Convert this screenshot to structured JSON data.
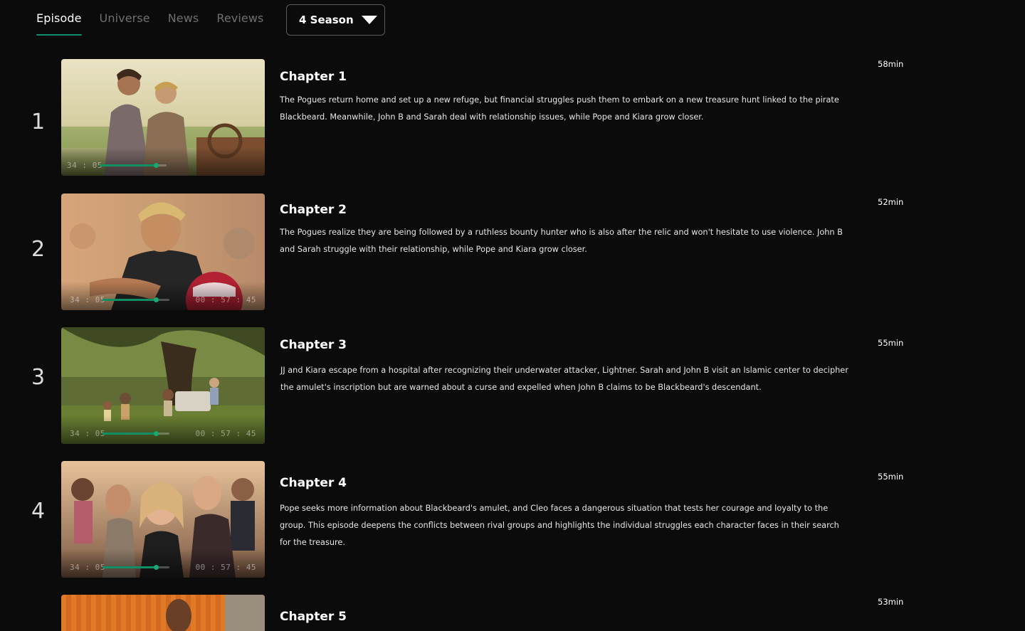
{
  "tabs": [
    {
      "label": "Episode",
      "active": true
    },
    {
      "label": "Universe",
      "active": false
    },
    {
      "label": "News",
      "active": false
    },
    {
      "label": "Reviews",
      "active": false
    }
  ],
  "season_select": {
    "value": "4 Season",
    "icon": "chevron-down-icon"
  },
  "accent_color": "#0f8f6b",
  "episodes": [
    {
      "number": "1",
      "title": "Chapter 1",
      "duration": "58min",
      "description": "The Pogues return home and set up a new refuge, but financial struggles push them to embark on a new treasure hunt linked to the pirate Blackbeard. Meanwhile, John B and Sarah deal with relationship issues, while Pope and Kiara grow closer.",
      "time_elapsed": "34 : 05",
      "time_total": "",
      "progress": 0.6
    },
    {
      "number": "2",
      "title": "Chapter 2",
      "duration": "52min",
      "description": "The Pogues  realize they are being followed by a ruthless bounty hunter who is also after the relic and won't hesitate to use violence. John B and Sarah struggle with their relationship, while Pope and Kiara grow closer.",
      "time_elapsed": "34 : 05",
      "time_total": "00 : 57 : 45",
      "progress": 0.6
    },
    {
      "number": "3",
      "title": "Chapter 3",
      "duration": "55min",
      "description": "JJ and Kiara escape from a hospital after recognizing their underwater attacker, Lightner. Sarah and John B visit an Islamic center to decipher the amulet's inscription but are warned about a curse and expelled when John B claims to be Blackbeard's descendant.",
      "time_elapsed": "34 : 05",
      "time_total": "00 : 57 : 45",
      "progress": 0.6
    },
    {
      "number": "4",
      "title": "Chapter 4",
      "duration": "55min",
      "description": "Pope seeks more information about Blackbeard's amulet, and Cleo faces a dangerous situation that tests her courage and loyalty to the group. This episode deepens the conflicts between rival groups and highlights the individual struggles each character faces in their search for the treasure.",
      "time_elapsed": "34 : 05",
      "time_total": "00 : 57 : 45",
      "progress": 0.6
    },
    {
      "number": "",
      "title": "Chapter 5",
      "duration": "53min",
      "description": "",
      "time_elapsed": "",
      "time_total": "",
      "progress": 0
    }
  ]
}
